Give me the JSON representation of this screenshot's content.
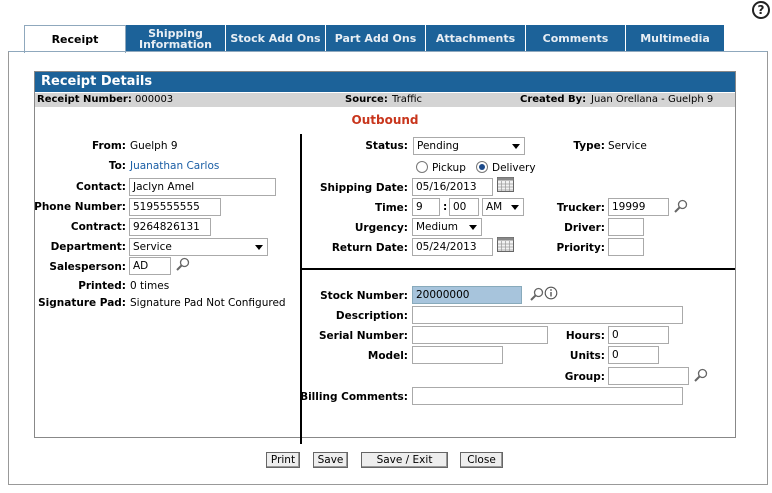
{
  "help_icon": "?",
  "tabs": [
    {
      "label": "Receipt",
      "active": true
    },
    {
      "label": "Shipping Information",
      "active": false
    },
    {
      "label": "Stock Add Ons",
      "active": false
    },
    {
      "label": "Part Add Ons",
      "active": false
    },
    {
      "label": "Attachments",
      "active": false
    },
    {
      "label": "Comments",
      "active": false
    },
    {
      "label": "Multimedia",
      "active": false
    }
  ],
  "panel_title": "Receipt Details",
  "info": {
    "receipt_number_label": "Receipt Number:",
    "receipt_number": "000003",
    "source_label": "Source:",
    "source": "Traffic",
    "created_by_label": "Created By:",
    "created_by": "Juan Orellana -  Guelph 9"
  },
  "direction": "Outbound",
  "left": {
    "from_label": "From:",
    "from": "Guelph 9",
    "to_label": "To:",
    "to": "Juanathan Carlos",
    "contact_label": "Contact:",
    "contact": "Jaclyn Amel",
    "phone_label": "Phone Number:",
    "phone": "5195555555",
    "contract_label": "Contract:",
    "contract": "9264826131",
    "department_label": "Department:",
    "department": "Service",
    "salesperson_label": "Salesperson:",
    "salesperson": "AD",
    "printed_label": "Printed:",
    "printed": "0 times",
    "signature_label": "Signature Pad:",
    "signature": "Signature Pad Not Configured"
  },
  "right": {
    "status_label": "Status:",
    "status": "Pending",
    "type_label": "Type:",
    "type": "Service",
    "pickup_label": "Pickup",
    "delivery_label": "Delivery",
    "selected_mode": "Delivery",
    "shipping_date_label": "Shipping Date:",
    "shipping_date": "05/16/2013",
    "time_label": "Time:",
    "time_hour": "9",
    "time_minute": "00",
    "time_ampm": "AM",
    "trucker_label": "Trucker:",
    "trucker": "19999",
    "urgency_label": "Urgency:",
    "urgency": "Medium",
    "driver_label": "Driver:",
    "driver": "",
    "return_date_label": "Return Date:",
    "return_date": "05/24/2013",
    "priority_label": "Priority:",
    "priority": ""
  },
  "stock": {
    "stock_number_label": "Stock Number:",
    "stock_number": "20000000",
    "description_label": "Description:",
    "description": "",
    "serial_label": "Serial Number:",
    "serial": "",
    "hours_label": "Hours:",
    "hours": "0",
    "model_label": "Model:",
    "model": "",
    "units_label": "Units:",
    "units": "0",
    "group_label": "Group:",
    "group": "",
    "billing_label": "Billing Comments:",
    "billing": ""
  },
  "buttons": {
    "print": "Print",
    "save": "Save",
    "save_exit": "Save / Exit",
    "close": "Close"
  }
}
